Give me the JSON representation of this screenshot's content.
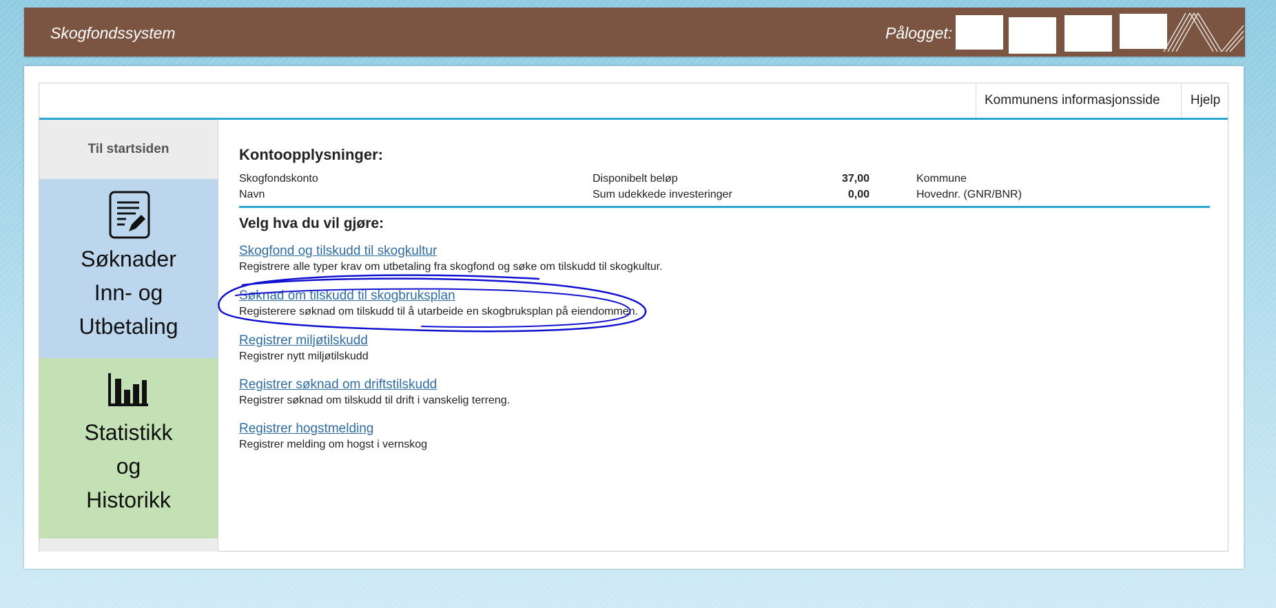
{
  "header": {
    "app_title": "Skogfondssystem",
    "login_label": "Pålogget:"
  },
  "topnav": {
    "info_link": "Kommunens informasjonsside",
    "help_link": "Hjelp"
  },
  "sidebar": {
    "start_label": "Til startsiden",
    "applications": {
      "lines": [
        "Søknader",
        "Inn- og",
        "Utbetaling"
      ],
      "icon": "document-edit-icon"
    },
    "statistics": {
      "lines": [
        "Statistikk",
        "og",
        "Historikk"
      ],
      "icon": "bar-chart-icon"
    }
  },
  "account": {
    "title": "Kontoopplysninger:",
    "rows": [
      {
        "label": "Skogfondskonto",
        "metric": "Disponibelt beløp",
        "value": "37,00",
        "extra": "Kommune"
      },
      {
        "label": "Navn",
        "metric": "Sum udekkede investeringer",
        "value": "0,00",
        "extra": "Hovednr. (GNR/BNR)"
      }
    ]
  },
  "actions": {
    "title": "Velg hva du vil gjøre:",
    "items": [
      {
        "link": "Skogfond og tilskudd til skogkultur",
        "desc": "Registrere alle typer krav om utbetaling fra skogfond og søke om tilskudd til skogkultur."
      },
      {
        "link": "Søknad om tilskudd til skogbruksplan",
        "desc": "Registerere søknad om tilskudd til å utarbeide en skogbruksplan på eiendommen."
      },
      {
        "link": "Registrer miljøtilskudd",
        "desc": "Registrer nytt miljøtilskudd"
      },
      {
        "link": "Registrer søknad om driftstilskudd",
        "desc": "Registrer søknad om tilskudd til drift i vanskelig terreng."
      },
      {
        "link": "Registrer hogstmelding",
        "desc": "Registrer melding om hogst i vernskog"
      }
    ]
  },
  "colors": {
    "header_bg": "#7b5541",
    "accent": "#2aa6d0",
    "link": "#2f6ea3",
    "annotation": "#1010d0"
  }
}
